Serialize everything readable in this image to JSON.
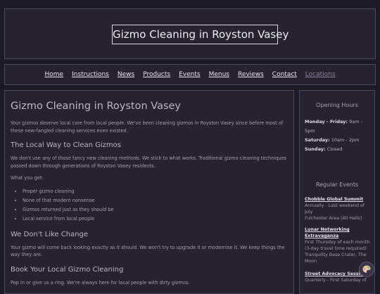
{
  "site": {
    "title": "Gizmo Cleaning in Royston Vasey"
  },
  "nav": {
    "items": [
      {
        "label": "Home"
      },
      {
        "label": "Instructions"
      },
      {
        "label": "News"
      },
      {
        "label": "Products"
      },
      {
        "label": "Events"
      },
      {
        "label": "Menus"
      },
      {
        "label": "Reviews"
      },
      {
        "label": "Contact"
      },
      {
        "label": "Locations"
      }
    ]
  },
  "main": {
    "heading": "Gizmo Cleaning in Royston Vasey",
    "intro": "Your gizmos deserve local care from local people. We've been cleaning gizmos in Royston Vasey since before most of these new-fangled cleaning services even existed.",
    "section1": {
      "heading": "The Local Way to Clean Gizmos",
      "text": "We don't use any of those fancy new cleaning methods. We stick to what works. Traditional gizmo cleaning techniques passed down through generations of Royston Vasey residents.",
      "list_intro": "What you get:",
      "items": [
        "Proper gizmo cleaning",
        "None of that modern nonsense",
        "Gizmos returned just as they should be",
        "Local service from local people"
      ]
    },
    "section2": {
      "heading": "We Don't Like Change",
      "text": "Your gizmo will come back looking exactly as it should. We won't try to upgrade it or modernise it. We keep things the way they are."
    },
    "section3": {
      "heading": "Book Your Local Gizmo Cleaning",
      "text": "Pop in or give us a ring. We're always here for local people with dirty gizmos."
    }
  },
  "sidebar": {
    "hours_title": "Opening Hours",
    "hours": [
      {
        "day": "Monday - Friday:",
        "time": "9am - 5pm"
      },
      {
        "day": "Saturday:",
        "time": "10am - 2pm"
      },
      {
        "day": "Sunday:",
        "time": "Closed"
      }
    ],
    "events_title": "Regular Events",
    "events": [
      {
        "title": "Chobble Global Summit",
        "when": "Annually - Last weekend of July",
        "where": "Fulchester Area (All Halls)"
      },
      {
        "title": "Lunar Networking Extravaganza",
        "when": "First Thursday of each month (3-day travel time required)",
        "where": "Tranquility Base Crater, The Moon"
      },
      {
        "title": "Street Advocacy Session",
        "when": "Quarterly - First Saturday of",
        "where": ""
      }
    ]
  },
  "fab": {
    "icon": "palette-icon"
  }
}
